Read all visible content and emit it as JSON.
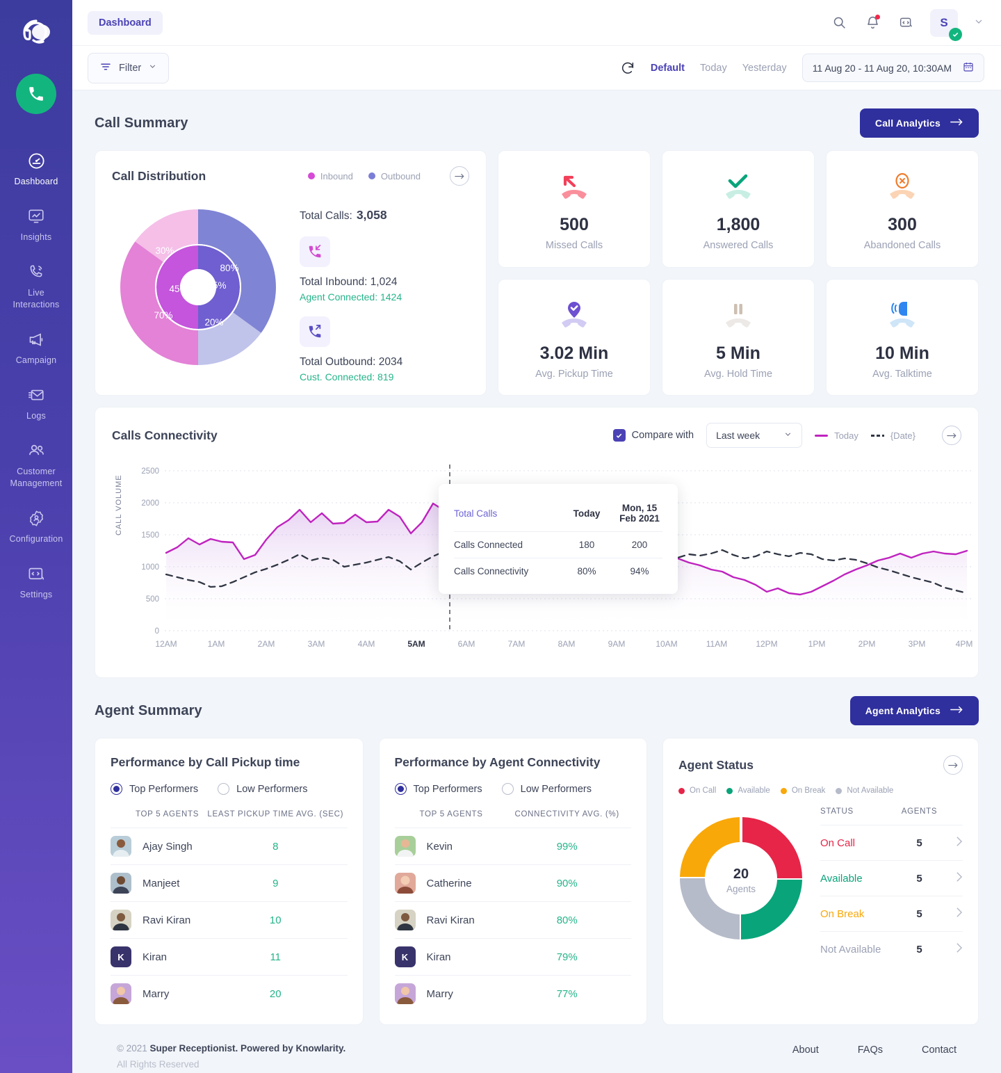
{
  "sidebar": {
    "brand_icon": "headset-logo-icon",
    "call_badge_icon": "phone-icon",
    "items": [
      {
        "label": "Dashboard",
        "icon": "speedometer-icon",
        "active": true
      },
      {
        "label": "Insights",
        "icon": "monitor-chart-icon",
        "active": false
      },
      {
        "label": "Live\nInteractions",
        "icon": "phone-signal-icon",
        "active": false
      },
      {
        "label": "Campaign",
        "icon": "megaphone-icon",
        "active": false
      },
      {
        "label": "Logs",
        "icon": "envelope-icon",
        "active": false
      },
      {
        "label": "Customer\nManagement",
        "icon": "people-icon",
        "active": false
      },
      {
        "label": "Configuration",
        "icon": "gear-user-icon",
        "active": false
      },
      {
        "label": "Settings",
        "icon": "code-wrench-icon",
        "active": false
      }
    ]
  },
  "topbar": {
    "page_chip": "Dashboard",
    "search_icon": "search-icon",
    "notifications_icon": "bell-icon",
    "developer_icon": "code-badge-icon",
    "avatar_initial": "S",
    "avatar_status_icon": "check-circle-icon",
    "caret_icon": "chevron-down-icon"
  },
  "filterbar": {
    "filter_label": "Filter",
    "filter_icon": "filter-icon",
    "filter_caret_icon": "chevron-down-icon",
    "refresh_icon": "refresh-icon",
    "presets": [
      {
        "label": "Default",
        "active": true
      },
      {
        "label": "Today",
        "active": false
      },
      {
        "label": "Yesterday",
        "active": false
      }
    ],
    "date_range": "11 Aug 20 - 11 Aug 20, 10:30AM",
    "calendar_icon": "calendar-icon"
  },
  "call_summary": {
    "title": "Call Summary",
    "analytics_button": "Call Analytics",
    "analytics_arrow_icon": "arrow-right-icon",
    "distribution": {
      "title": "Call Distribution",
      "legend": [
        {
          "label": "Inbound",
          "color": "#d64ad6"
        },
        {
          "label": "Outbound",
          "color": "#7b7ed6"
        }
      ],
      "expand_icon": "arrow-right-circle-icon",
      "total_label": "Total Calls:",
      "total_value": "3,058",
      "inbound": {
        "icon": "call-incoming-icon",
        "main": "Total Inbound: 1,024",
        "sub": "Agent Connected: 1424"
      },
      "outbound": {
        "icon": "call-outgoing-icon",
        "main": "Total Outbound: 2034",
        "sub": "Cust. Connected: 819"
      }
    },
    "kpis": [
      {
        "icon": "missed-call-icon",
        "value": "500",
        "label": "Missed Calls",
        "color": "#f25a68"
      },
      {
        "icon": "answered-call-icon",
        "value": "1,800",
        "label": "Answered Calls",
        "color": "#13b57e"
      },
      {
        "icon": "abandoned-call-icon",
        "value": "300",
        "label": "Abandoned Calls",
        "color": "#f07b2a"
      },
      {
        "icon": "pickup-time-icon",
        "value": "3.02 Min",
        "label": "Avg. Pickup Time",
        "color": "#7a5ad6"
      },
      {
        "icon": "hold-time-icon",
        "value": "5 Min",
        "label": "Avg. Hold Time",
        "color": "#c9bfb5"
      },
      {
        "icon": "talktime-icon",
        "value": "10 Min",
        "label": "Avg. Talktime",
        "color": "#3b82f6"
      }
    ]
  },
  "connectivity": {
    "title": "Calls Connectivity",
    "compare_label": "Compare with",
    "compare_checked": true,
    "compare_check_icon": "check-icon",
    "compare_value": "Last week",
    "compare_caret_icon": "chevron-down-icon",
    "legend": [
      {
        "label": "Today",
        "style": "solid",
        "color": "#bf23bf"
      },
      {
        "label": "{Date}",
        "style": "dashed",
        "color": "#2f3542"
      }
    ],
    "expand_icon": "arrow-right-circle-icon",
    "tooltip": {
      "header": [
        "Total Calls",
        "Today",
        "Mon, 15 Feb 2021"
      ],
      "rows": [
        [
          "Calls Connected",
          "180",
          "200"
        ],
        [
          "Calls Connectivity",
          "80%",
          "94%"
        ]
      ]
    }
  },
  "agent_summary": {
    "title": "Agent Summary",
    "analytics_button": "Agent Analytics",
    "analytics_arrow_icon": "arrow-right-icon",
    "pickup_card": {
      "title": "Performance by Call Pickup time",
      "options": [
        {
          "label": "Top Performers",
          "selected": true
        },
        {
          "label": "Low Performers",
          "selected": false
        }
      ],
      "columns": [
        "TOP 5 AGENTS",
        "LEAST PICKUP TIME AVG. (SEC)"
      ],
      "rows": [
        {
          "name": "Ajay Singh",
          "value": "8",
          "avatar": "photo"
        },
        {
          "name": "Manjeet",
          "value": "9",
          "avatar": "photo"
        },
        {
          "name": "Ravi Kiran",
          "value": "10",
          "avatar": "photo"
        },
        {
          "name": "Kiran",
          "value": "11",
          "avatar": "K"
        },
        {
          "name": "Marry",
          "value": "20",
          "avatar": "photo"
        }
      ]
    },
    "connectivity_card": {
      "title": "Performance by Agent Connectivity",
      "options": [
        {
          "label": "Top Performers",
          "selected": true
        },
        {
          "label": "Low Performers",
          "selected": false
        }
      ],
      "columns": [
        "TOP 5 AGENTS",
        "CONNECTIVITY AVG. (%)"
      ],
      "rows": [
        {
          "name": "Kevin",
          "value": "99%",
          "avatar": "photo"
        },
        {
          "name": "Catherine",
          "value": "90%",
          "avatar": "photo"
        },
        {
          "name": "Ravi Kiran",
          "value": "80%",
          "avatar": "photo"
        },
        {
          "name": "Kiran",
          "value": "79%",
          "avatar": "K"
        },
        {
          "name": "Marry",
          "value": "77%",
          "avatar": "photo"
        }
      ]
    },
    "status_card": {
      "title": "Agent Status",
      "expand_icon": "arrow-right-circle-icon",
      "legend": [
        {
          "label": "On Call",
          "color": "#e62548"
        },
        {
          "label": "Available",
          "color": "#09a47a"
        },
        {
          "label": "On Break",
          "color": "#f9a80a"
        },
        {
          "label": "Not Available",
          "color": "#b6bbc9"
        }
      ],
      "center_value": "20",
      "center_label": "Agents",
      "columns": [
        "STATUS",
        "AGENTS"
      ],
      "rows": [
        {
          "status": "On Call",
          "agents": "5",
          "color": "#e62548"
        },
        {
          "status": "Available",
          "agents": "5",
          "color": "#09a47a"
        },
        {
          "status": "On Break",
          "agents": "5",
          "color": "#f9a80a"
        },
        {
          "status": "Not Available",
          "agents": "5",
          "color": "#9ba1b4"
        }
      ],
      "chevron_icon": "chevron-right-icon"
    }
  },
  "footer": {
    "copyright_prefix": "© 2021 ",
    "copyright_brand": "Super Receptionist. Powered by Knowlarity.",
    "rights": "All Rights Reserved",
    "links": [
      "About",
      "FAQs",
      "Contact"
    ]
  },
  "chart_data": [
    {
      "type": "pie",
      "title": "Call Distribution",
      "subtype": "nested-donut",
      "outer_ring": [
        {
          "label": "Outbound 80%",
          "value": 80,
          "color": "#8084d4",
          "span_pct": 40
        },
        {
          "label": "Outbound 20%",
          "value": 20,
          "color": "#c0c3ea",
          "span_pct": 10
        },
        {
          "label": "Inbound 70%",
          "value": 70,
          "color": "#e382d6",
          "span_pct": 35
        },
        {
          "label": "Inbound 30%",
          "value": 30,
          "color": "#f5bfe8",
          "span_pct": 15
        }
      ],
      "inner_ring": [
        {
          "label": "55%",
          "value": 55,
          "color": "#6f5fd0",
          "span_pct": 50
        },
        {
          "label": "45%",
          "value": 45,
          "color": "#c455dc",
          "span_pct": 50
        }
      ],
      "legend": [
        "Inbound",
        "Outbound"
      ],
      "total": 3058
    },
    {
      "type": "line",
      "title": "Calls Connectivity",
      "xlabel": "",
      "ylabel": "CALL VOLUME",
      "ylim": [
        0,
        2500
      ],
      "yticks": [
        0,
        500,
        1000,
        1500,
        2000,
        2500
      ],
      "xticks": [
        "12AM",
        "1AM",
        "2AM",
        "3AM",
        "4AM",
        "5AM",
        "6AM",
        "7AM",
        "8AM",
        "9AM",
        "10AM",
        "11AM",
        "12PM",
        "1PM",
        "2PM",
        "3PM",
        "4PM"
      ],
      "grid": true,
      "marker_x": "5AM",
      "marker_y": 1530,
      "legend_position": "top-right",
      "series": [
        {
          "name": "Today",
          "style": "solid",
          "color": "#bf23bf",
          "values": [
            1220,
            1310,
            1450,
            1350,
            1430,
            1390,
            1380,
            1120,
            1180,
            1420,
            1620,
            1730,
            1890,
            1700,
            1820,
            1660,
            1670,
            1800,
            1690,
            1700,
            1860,
            1750,
            1520,
            1700,
            1990,
            1880,
            1970,
            1940,
            1700,
            1600,
            1530,
            1330,
            1320,
            740,
            700,
            670,
            690,
            620,
            610,
            700,
            780,
            830,
            900,
            1000,
            1130,
            1200,
            1120,
            1220,
            1150,
            1100,
            1040,
            1010,
            940,
            900,
            820,
            700,
            760,
            680,
            650,
            690,
            780,
            870,
            960,
            1030,
            1100,
            1180,
            1230,
            1300,
            1230,
            1290,
            1330,
            1300,
            1290,
            1340
          ]
        },
        {
          "name": "{Date}",
          "style": "dashed",
          "color": "#2f3542",
          "values": [
            880,
            840,
            800,
            760,
            690,
            700,
            760,
            830,
            900,
            950,
            1020,
            1090,
            1170,
            1080,
            1120,
            1090,
            1000,
            1030,
            1060,
            1100,
            1150,
            1080,
            950,
            1050,
            1150,
            1220,
            1190,
            1220,
            1200,
            1130,
            1080,
            1010,
            940,
            900,
            930,
            880,
            960,
            1030,
            1060,
            1010,
            1060,
            1000,
            980,
            990,
            960,
            1030,
            1120,
            1180,
            1150,
            1190,
            1240,
            1160,
            1110,
            1150,
            1220,
            1180,
            1140,
            1200,
            1170,
            1100,
            1080,
            1110,
            1090,
            1040,
            980,
            940,
            890,
            840,
            790,
            760,
            720,
            660,
            620
          ]
        }
      ]
    },
    {
      "type": "pie",
      "title": "Agent Status",
      "subtype": "donut",
      "labels": [
        "On Call",
        "Available",
        "On Break",
        "Not Available"
      ],
      "values": [
        5,
        5,
        5,
        5
      ],
      "colors": [
        "#e62548",
        "#09a47a",
        "#f9a80a",
        "#b6bbc9"
      ],
      "center_value": 20,
      "center_label": "Agents"
    }
  ]
}
